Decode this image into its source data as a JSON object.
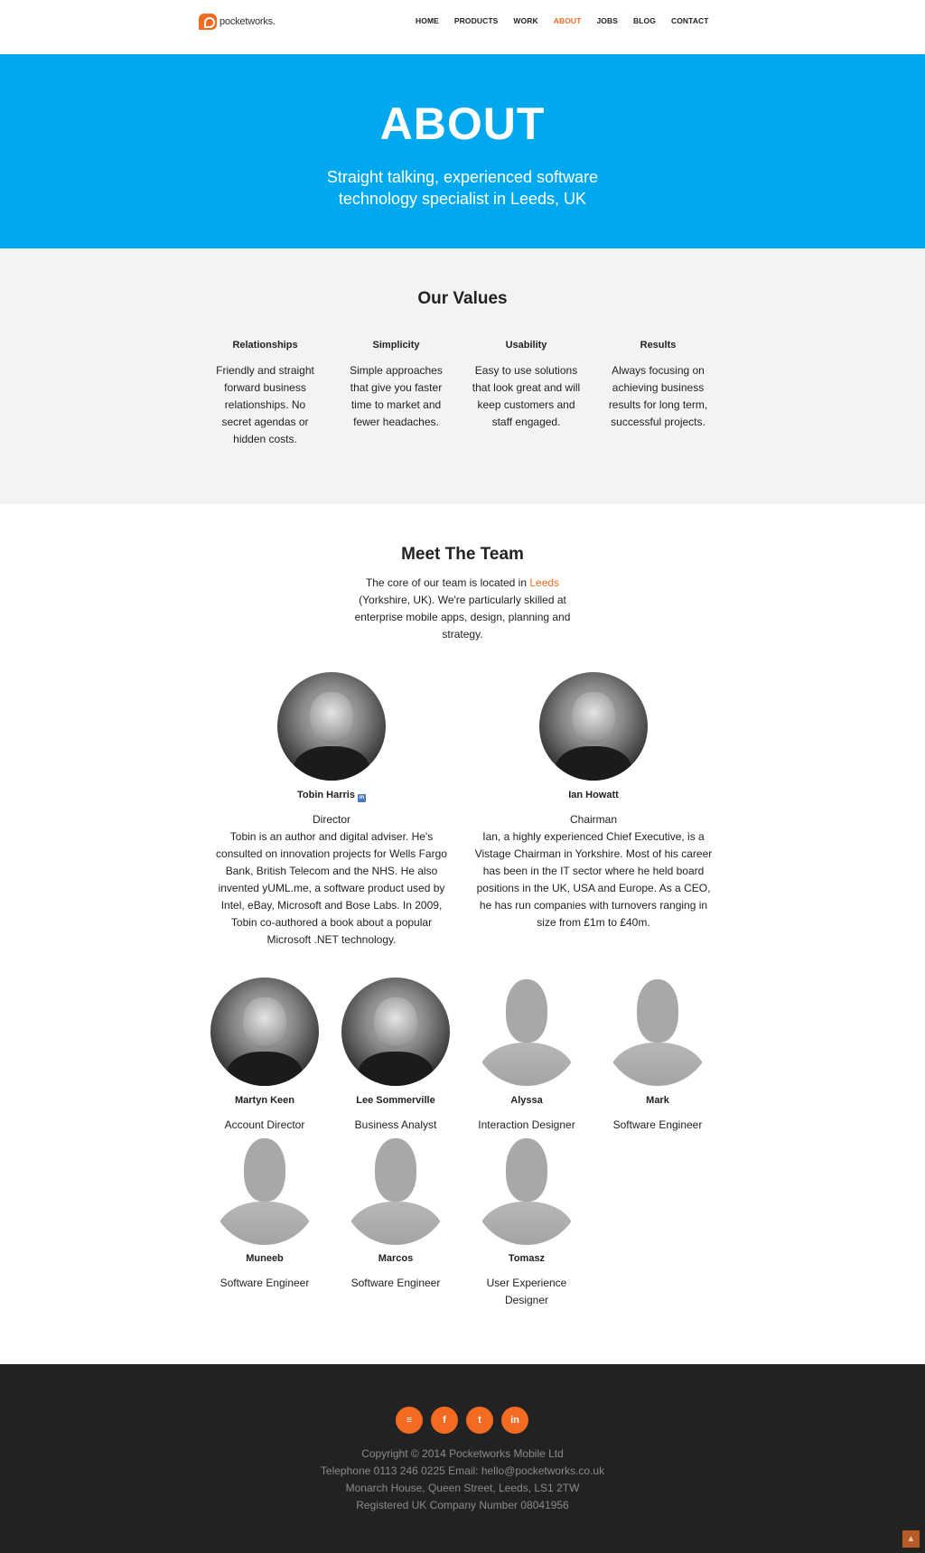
{
  "header": {
    "logo_text": "pocketworks.",
    "nav": [
      "HOME",
      "PRODUCTS",
      "WORK",
      "ABOUT",
      "JOBS",
      "BLOG",
      "CONTACT"
    ],
    "active_nav": "ABOUT"
  },
  "hero": {
    "title": "ABOUT",
    "subtitle": "Straight talking, experienced software technology specialist in Leeds, UK"
  },
  "values": {
    "title": "Our Values",
    "items": [
      {
        "title": "Relationships",
        "text": "Friendly and straight forward business relationships. No secret agendas or hidden costs."
      },
      {
        "title": "Simplicity",
        "text": "Simple approaches that give you faster time to market and fewer headaches."
      },
      {
        "title": "Usability",
        "text": "Easy to use solutions that look great and will keep customers and staff engaged."
      },
      {
        "title": "Results",
        "text": "Always focusing on achieving business results for long term, successful projects."
      }
    ]
  },
  "team": {
    "title": "Meet The Team",
    "intro_before": "The core of our team is located in ",
    "intro_link": "Leeds",
    "intro_after": " (Yorkshire, UK). We're particularly skilled at enterprise mobile apps, design, planning and strategy.",
    "leaders": [
      {
        "name": "Tobin Harris",
        "role": "Director",
        "bio": "Tobin is an author and digital adviser. He's consulted on innovation projects for Wells Fargo Bank, British Telecom and the NHS. He also invented yUML.me, a software product used by Intel, eBay, Microsoft and Bose Labs. In 2009, Tobin co-authored a book about a popular Microsoft .NET technology."
      },
      {
        "name": "Ian Howatt",
        "role": "Chairman",
        "bio": "Ian, a highly experienced Chief Executive, is a Vistage Chairman in Yorkshire. Most of his career has been in the IT sector where he held board positions in the UK, USA and Europe. As a CEO, he has run companies with turnovers ranging in size from £1m to £40m."
      }
    ],
    "members": [
      {
        "name": "Martyn Keen",
        "role": "Account Director"
      },
      {
        "name": "Lee Sommerville",
        "role": "Business Analyst"
      },
      {
        "name": "Alyssa",
        "role": "Interaction Designer"
      },
      {
        "name": "Mark",
        "role": "Software Engineer"
      },
      {
        "name": "Muneeb",
        "role": "Software Engineer"
      },
      {
        "name": "Marcos",
        "role": "Software Engineer"
      },
      {
        "name": "Tomasz",
        "role": "User Experience Designer"
      }
    ]
  },
  "footer": {
    "social": [
      "rss-icon",
      "facebook-icon",
      "twitter-icon",
      "linkedin-icon"
    ],
    "social_glyphs": [
      "≡",
      "f",
      "t",
      "in"
    ],
    "lines": [
      "Copyright © 2014 Pocketworks Mobile Ltd",
      "Telephone 0113 246 0225 Email: hello@pocketworks.co.uk",
      "Monarch House, Queen Street, Leeds, LS1 2TW",
      "Registered UK Company Number 08041956"
    ]
  },
  "colors": {
    "accent": "#f26b21",
    "hero": "#00a8ee",
    "footer": "#222222"
  }
}
